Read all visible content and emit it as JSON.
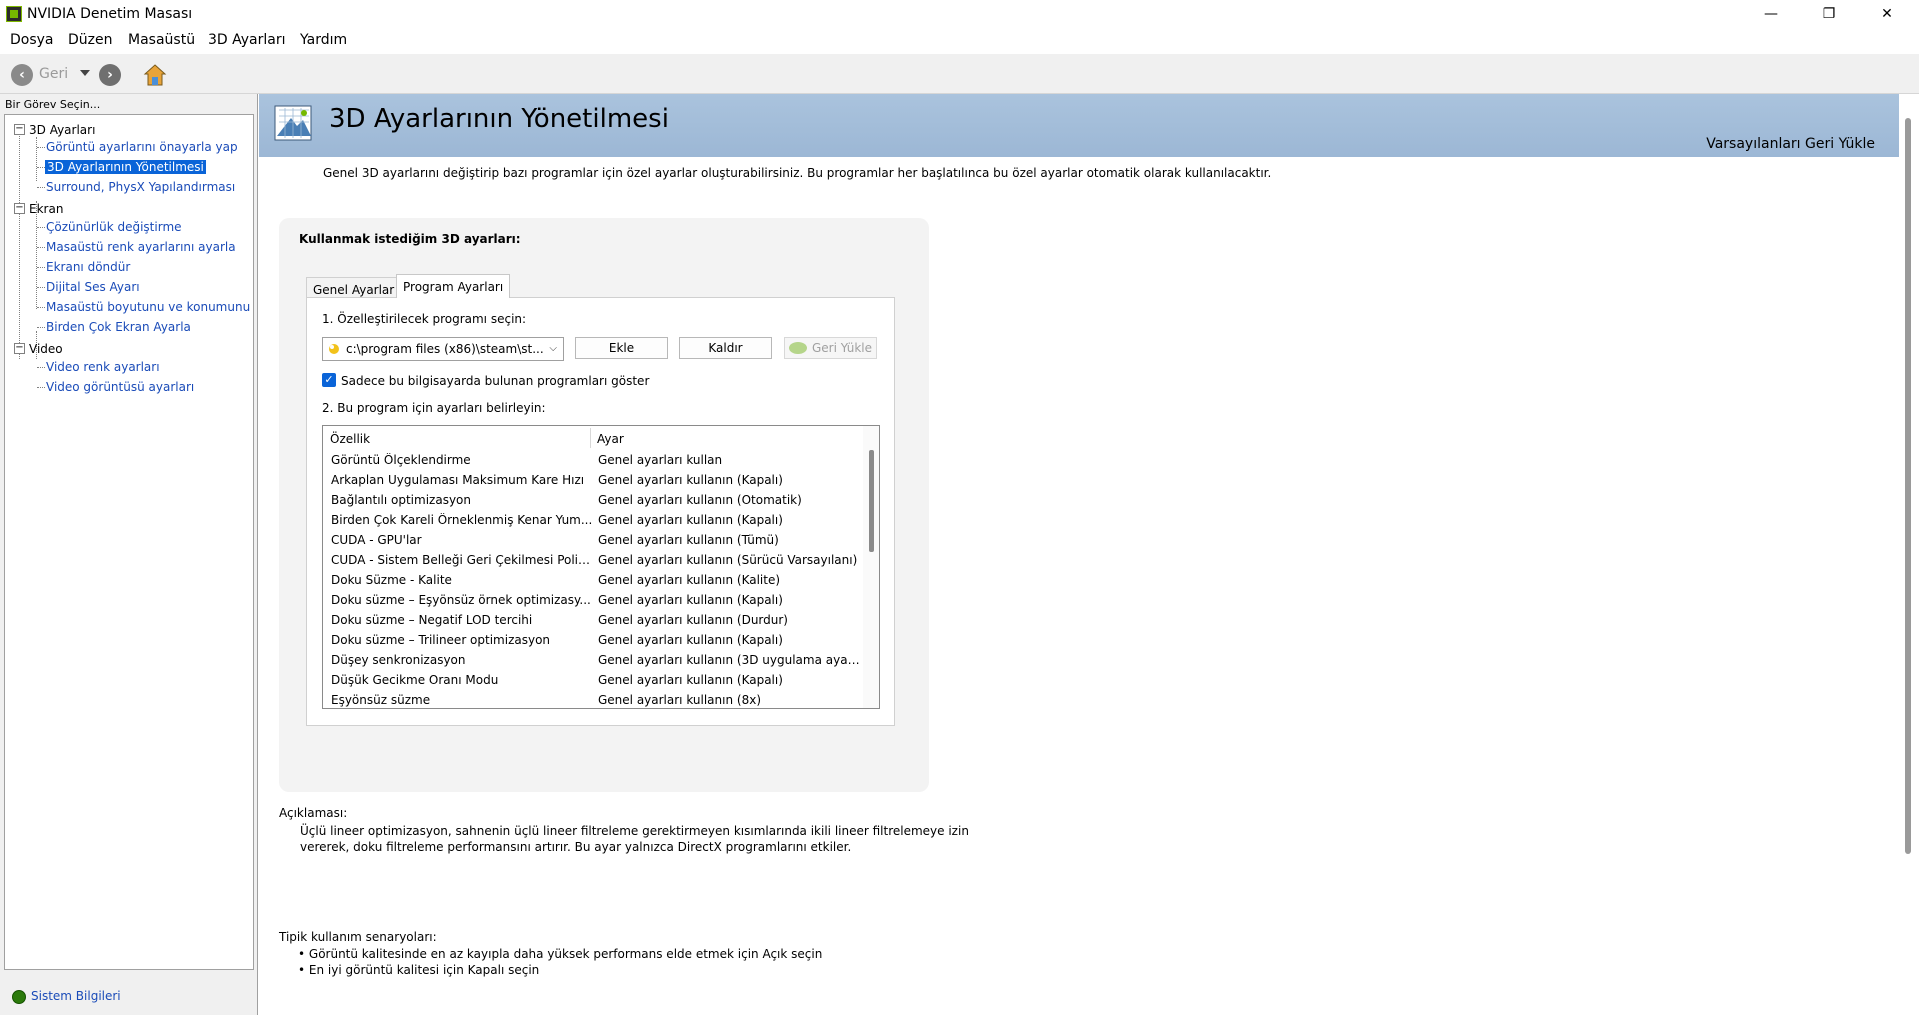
{
  "window": {
    "title": "NVIDIA Denetim Masası",
    "minimize": "—",
    "maximize": "❐",
    "close": "✕"
  },
  "menu": [
    "Dosya",
    "Düzen",
    "Masaüstü",
    "3D Ayarları",
    "Yardım"
  ],
  "toolbar": {
    "back_label": "Geri"
  },
  "left": {
    "task_header": "Bir Görev Seçin...",
    "sections": [
      {
        "label": "3D Ayarları",
        "toggle": "−",
        "items": [
          {
            "label": "Görüntü ayarlarını önayarla yap"
          },
          {
            "label": "3D Ayarlarının Yönetilmesi"
          },
          {
            "label": "Surround, PhysX Yapılandırması"
          }
        ]
      },
      {
        "label": "Ekran",
        "toggle": "−",
        "items": [
          {
            "label": "Çözünürlük değiştirme"
          },
          {
            "label": "Masaüstü renk ayarlarını ayarla"
          },
          {
            "label": "Ekranı döndür"
          },
          {
            "label": "Dijital Ses Ayarı"
          },
          {
            "label": "Masaüstü boyutunu ve konumunu ay"
          },
          {
            "label": "Birden Çok Ekran Ayarla"
          }
        ]
      },
      {
        "label": "Video",
        "toggle": "−",
        "items": [
          {
            "label": "Video renk ayarları"
          },
          {
            "label": "Video görüntüsü ayarları"
          }
        ]
      }
    ],
    "system_info": "Sistem Bilgileri"
  },
  "main": {
    "title": "3D Ayarlarının Yönetilmesi",
    "restore_defaults": "Varsayılanları Geri Yükle",
    "intro": "Genel 3D ayarlarını değiştirip bazı programlar için özel ayarlar oluşturabilirsiniz. Bu programlar her başlatılınca bu özel ayarlar otomatik olarak kullanılacaktır.",
    "group_title": "Kullanmak istediğim 3D ayarları:",
    "tabs": [
      {
        "label": "Genel Ayarlar"
      },
      {
        "label": "Program Ayarları"
      }
    ],
    "step1": "1. Özelleştirilecek programı seçin:",
    "program_value": "c:\\program files (x86)\\steam\\st...",
    "add_button": "Ekle",
    "remove_button": "Kaldır",
    "restore_button": "Geri Yükle",
    "only_installed": "Sadece bu bilgisayarda bulunan programları göster",
    "checkmark": "✓",
    "step2": "2. Bu program için ayarları belirleyin:",
    "columns": {
      "feature": "Özellik",
      "setting": "Ayar"
    },
    "rows": [
      {
        "feature": "Görüntü Ölçeklendirme",
        "setting": "Genel ayarları kullan"
      },
      {
        "feature": "Arkaplan Uygulaması Maksimum Kare Hızı",
        "setting": "Genel ayarları kullanın (Kapalı)"
      },
      {
        "feature": "Bağlantılı optimizasyon",
        "setting": "Genel ayarları kullanın (Otomatik)"
      },
      {
        "feature": "Birden Çok Kareli Örneklenmiş Kenar Yum...",
        "setting": "Genel ayarları kullanın (Kapalı)"
      },
      {
        "feature": "CUDA - GPU'lar",
        "setting": "Genel ayarları kullanın (Tümü)"
      },
      {
        "feature": "CUDA - Sistem Belleği Geri Çekilmesi Polit...",
        "setting": "Genel ayarları kullanın (Sürücü Varsayılanı)"
      },
      {
        "feature": "Doku Süzme - Kalite",
        "setting": "Genel ayarları kullanın (Kalite)"
      },
      {
        "feature": "Doku süzme – Eşyönsüz örnek optimizasy...",
        "setting": "Genel ayarları kullanın (Kapalı)"
      },
      {
        "feature": "Doku süzme – Negatif LOD tercihi",
        "setting": "Genel ayarları kullanın (Durdur)"
      },
      {
        "feature": "Doku süzme – Trilineer optimizasyon",
        "setting": "Genel ayarları kullanın (Kapalı)"
      },
      {
        "feature": "Düşey senkronizasyon",
        "setting": "Genel ayarları kullanın (3D uygulama ayar..."
      },
      {
        "feature": "Düşük Gecikme Oranı Modu",
        "setting": "Genel ayarları kullanın (Kapalı)"
      },
      {
        "feature": "Eşyönsüz süzme",
        "setting": "Genel ayarları kullanın (8x)"
      }
    ],
    "description_label": "Açıklaması:",
    "description": "Üçlü lineer optimizasyon, sahnenin üçlü lineer filtreleme gerektirmeyen kısımlarında ikili lineer filtrelemeye izin vererek, doku filtreleme performansını artırır. Bu ayar yalnızca DirectX programlarını etkiler.",
    "usage_label": "Tipik kullanım senaryoları:",
    "usage": [
      "• Görüntü kalitesinde en az kayıpla daha yüksek performans elde etmek için Açık seçin",
      "• En iyi görüntü kalitesi için Kapalı seçin"
    ]
  },
  "colors": {
    "banner": "#9cb7d5",
    "selected": "#0a64d8",
    "link": "#1a4bb8"
  }
}
